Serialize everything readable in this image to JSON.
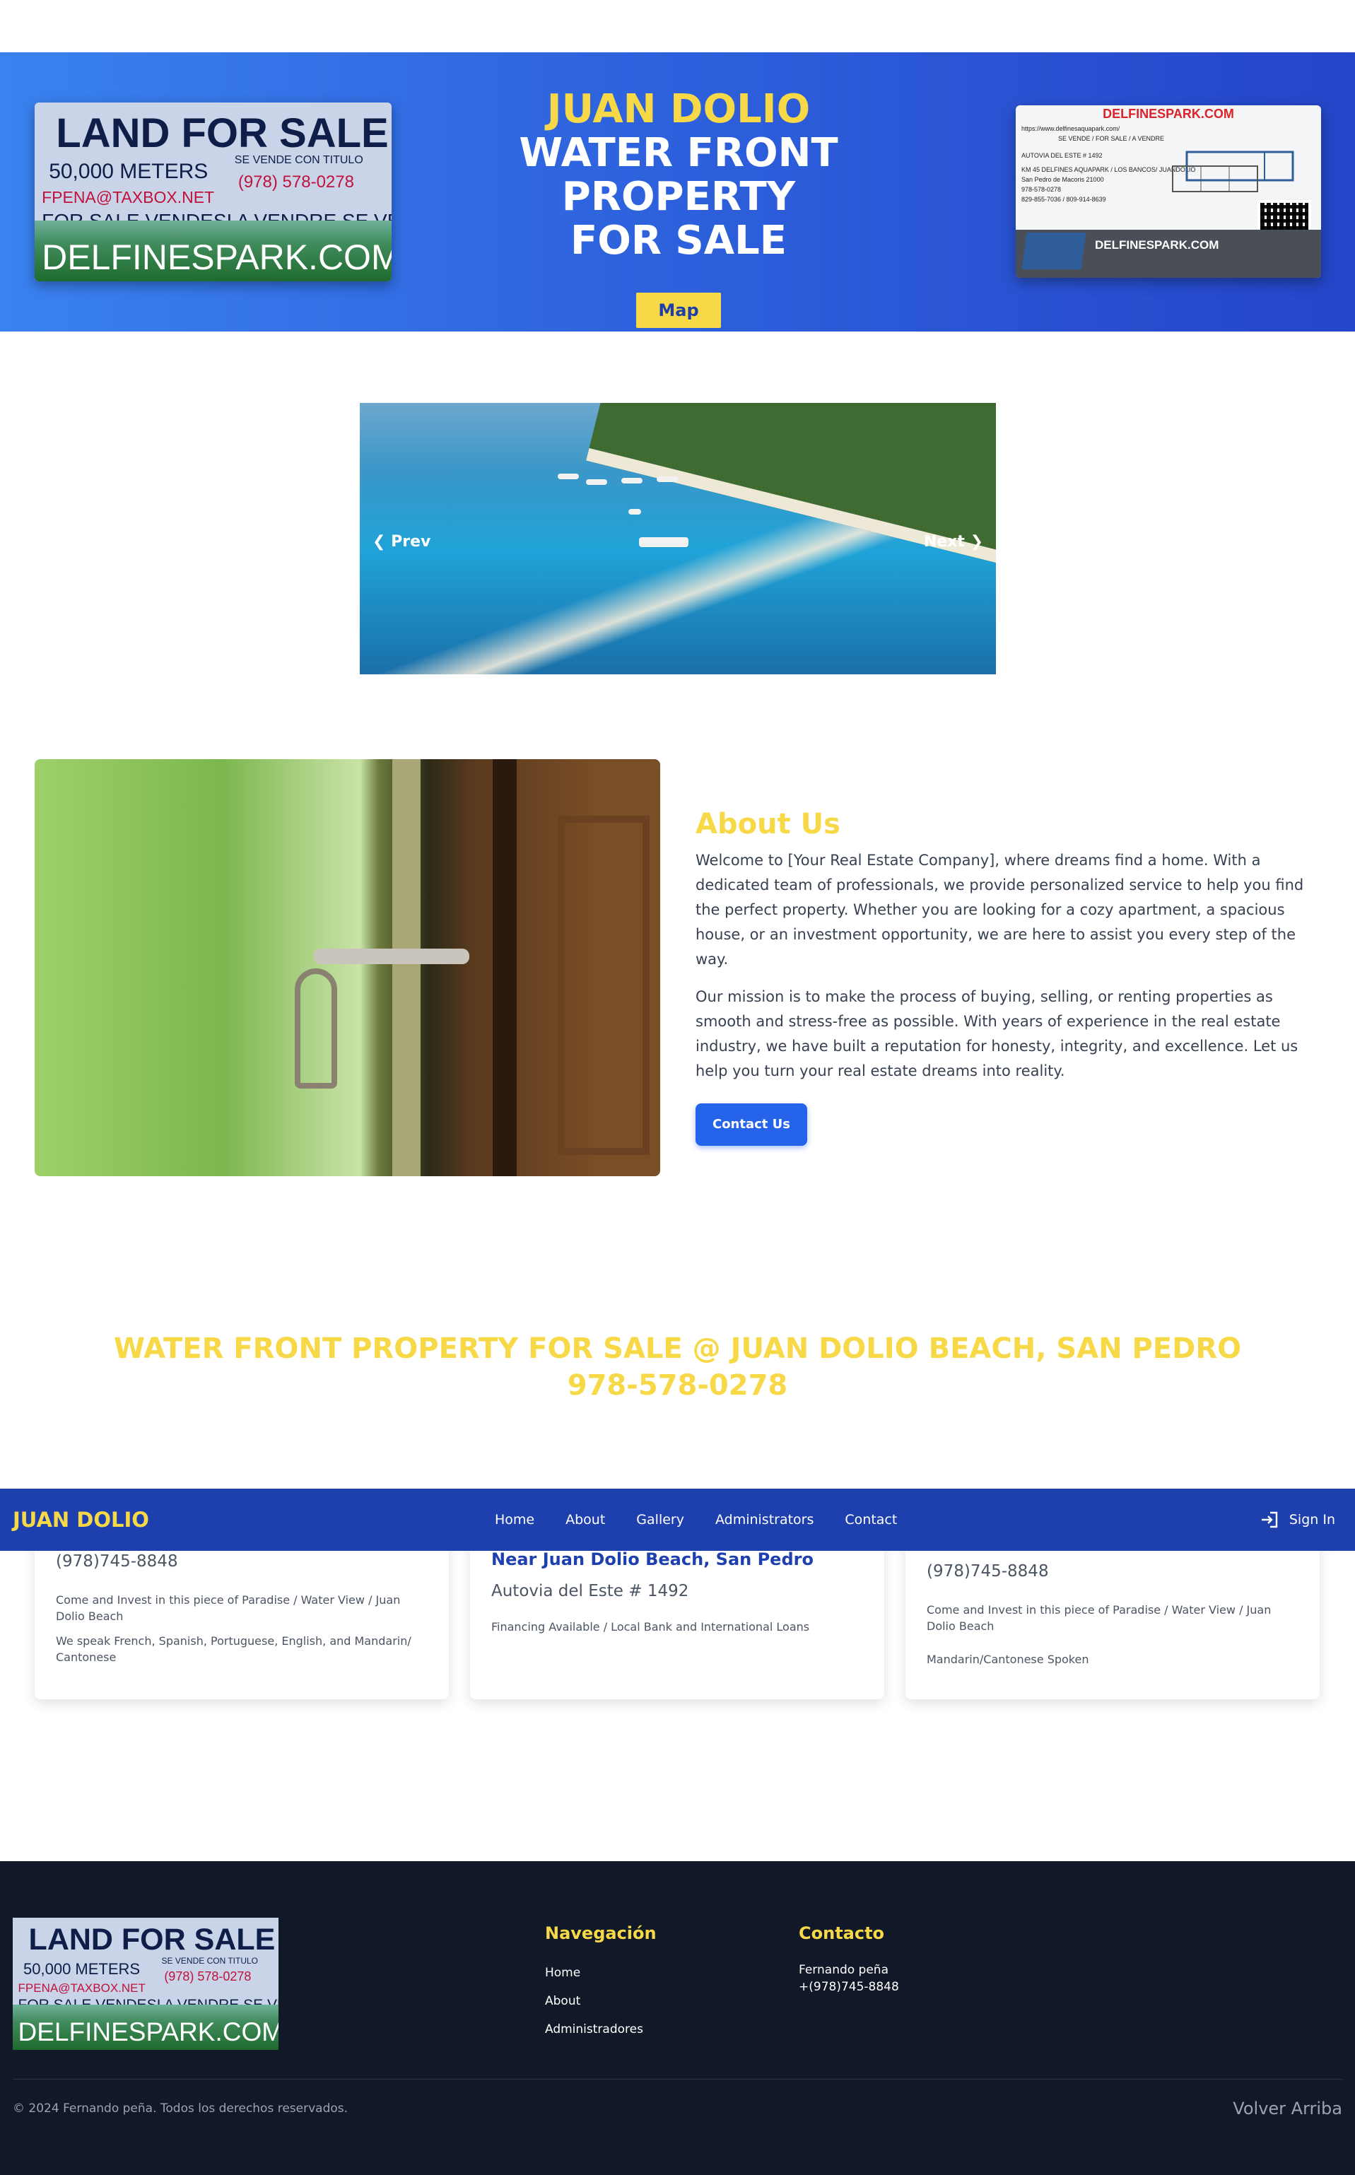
{
  "hero": {
    "top_line": "JUAN DOLIO",
    "title_line1": "WATER FRONT PROPERTY",
    "title_line2": "FOR SALE",
    "map_label": "Map"
  },
  "land_sign": {
    "headline": "LAND FOR SALE",
    "size": "50,000 METERS",
    "title_note": "SE VENDE CON TITULO",
    "phone": "(978) 578-0278",
    "email": "FPENA@TAXBOX.NET",
    "languages": "FOR SALE   VENDESI        A VENDRE        SE VENDE",
    "site": "DELFINESPARK.COM"
  },
  "delfines_sign": {
    "title": "DELFINESPARK.COM",
    "lines": [
      "https://www.delfinesaquapark.com/",
      "SE VENDE / FOR SALE / A VENDRE",
      "AUTOVIA DEL ESTE # 1492",
      "KM 45 DELFINES AQUAPARK / LOS BANCOS/ JUANDOLIO",
      "San Pedro de Macoris 21000",
      "978-578-0278",
      "829-855-7036 / 809-914-8639"
    ],
    "site": "DELFINESPARK.COM"
  },
  "carousel": {
    "prev_label": "Prev",
    "next_label": "Next"
  },
  "about": {
    "title": "About Us",
    "p1": "Welcome to [Your Real Estate Company], where dreams find a home. With a dedicated team of professionals, we provide personalized service to help you find the perfect property. Whether you are looking for a cozy apartment, a spacious house, or an investment opportunity, we are here to assist you every step of the way.",
    "p2": "Our mission is to make the process of buying, selling, or renting properties as smooth and stress-free as possible. With years of experience in the real estate industry, we have built a reputation for honesty, integrity, and excellence. Let us help you turn your real estate dreams into reality.",
    "contact_label": "Contact Us"
  },
  "banner": {
    "line1": "WATER FRONT PROPERTY FOR SALE @ JUAN DOLIO BEACH, SAN PEDRO",
    "line2": "978-578-0278"
  },
  "navbar": {
    "brand": "JUAN DOLIO",
    "links": [
      "Home",
      "About",
      "Gallery",
      "Administrators",
      "Contact"
    ],
    "signin_label": "Sign In"
  },
  "cards": [
    {
      "phone": "(978)745-8848",
      "text1": "Come and Invest in this piece of Paradise / Water View / Juan Dolio Beach",
      "text2": "We speak French, Spanish, Portuguese, English, and Mandarin/ Cantonese"
    },
    {
      "location": "Near Juan Dolio Beach, San Pedro",
      "address": "Autovia del Este # 1492",
      "text1": "Financing Available / Local Bank and International Loans"
    },
    {
      "phone": "(978)745-8848",
      "text1": "Come and Invest in this piece of Paradise / Water View / Juan Dolio Beach",
      "text2": "Mandarin/Cantonese Spoken"
    }
  ],
  "footer": {
    "nav_title": "Navegación",
    "nav_links": [
      "Home",
      "About",
      "Administradores"
    ],
    "contact_title": "Contacto",
    "contact_name": "Fernando peña",
    "contact_phone": "+(978)745-8848",
    "copyright": "© 2024 Fernando peña. Todos los derechos reservados.",
    "back_to_top": "Volver Arriba"
  },
  "colors": {
    "accent_yellow": "#f7d948",
    "nav_blue": "#1e40af",
    "button_blue": "#2563eb",
    "footer_bg": "#111827"
  }
}
